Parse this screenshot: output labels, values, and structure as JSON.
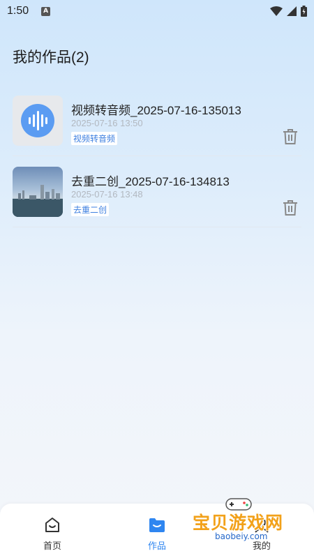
{
  "status": {
    "time": "1:50",
    "a_badge": "A"
  },
  "page": {
    "title": "我的作品(2)"
  },
  "works": [
    {
      "title": "视频转音频_2025-07-16-135013",
      "date": "2025-07-16 13:50",
      "tag": "视频转音频",
      "thumb": "audio-wave-icon"
    },
    {
      "title": "去重二创_2025-07-16-134813",
      "date": "2025-07-16 13:48",
      "tag": "去重二创",
      "thumb": "photo"
    }
  ],
  "nav": {
    "home_label": "首页",
    "works_label": "作品",
    "mine_label": "我的",
    "active_color": "#2f86f0"
  },
  "watermark": {
    "title": "宝贝游戏网",
    "url": "baobeiy.com"
  }
}
